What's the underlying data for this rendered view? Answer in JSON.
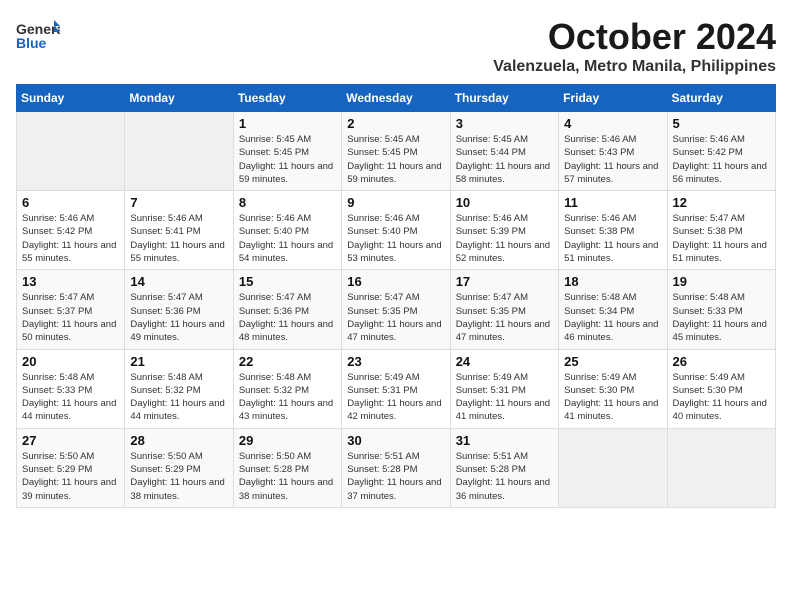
{
  "logo": {
    "general": "General",
    "blue": "Blue"
  },
  "title": "October 2024",
  "location": "Valenzuela, Metro Manila, Philippines",
  "weekdays": [
    "Sunday",
    "Monday",
    "Tuesday",
    "Wednesday",
    "Thursday",
    "Friday",
    "Saturday"
  ],
  "weeks": [
    [
      {
        "day": "",
        "info": ""
      },
      {
        "day": "",
        "info": ""
      },
      {
        "day": "1",
        "info": "Sunrise: 5:45 AM\nSunset: 5:45 PM\nDaylight: 11 hours and 59 minutes."
      },
      {
        "day": "2",
        "info": "Sunrise: 5:45 AM\nSunset: 5:45 PM\nDaylight: 11 hours and 59 minutes."
      },
      {
        "day": "3",
        "info": "Sunrise: 5:45 AM\nSunset: 5:44 PM\nDaylight: 11 hours and 58 minutes."
      },
      {
        "day": "4",
        "info": "Sunrise: 5:46 AM\nSunset: 5:43 PM\nDaylight: 11 hours and 57 minutes."
      },
      {
        "day": "5",
        "info": "Sunrise: 5:46 AM\nSunset: 5:42 PM\nDaylight: 11 hours and 56 minutes."
      }
    ],
    [
      {
        "day": "6",
        "info": "Sunrise: 5:46 AM\nSunset: 5:42 PM\nDaylight: 11 hours and 55 minutes."
      },
      {
        "day": "7",
        "info": "Sunrise: 5:46 AM\nSunset: 5:41 PM\nDaylight: 11 hours and 55 minutes."
      },
      {
        "day": "8",
        "info": "Sunrise: 5:46 AM\nSunset: 5:40 PM\nDaylight: 11 hours and 54 minutes."
      },
      {
        "day": "9",
        "info": "Sunrise: 5:46 AM\nSunset: 5:40 PM\nDaylight: 11 hours and 53 minutes."
      },
      {
        "day": "10",
        "info": "Sunrise: 5:46 AM\nSunset: 5:39 PM\nDaylight: 11 hours and 52 minutes."
      },
      {
        "day": "11",
        "info": "Sunrise: 5:46 AM\nSunset: 5:38 PM\nDaylight: 11 hours and 51 minutes."
      },
      {
        "day": "12",
        "info": "Sunrise: 5:47 AM\nSunset: 5:38 PM\nDaylight: 11 hours and 51 minutes."
      }
    ],
    [
      {
        "day": "13",
        "info": "Sunrise: 5:47 AM\nSunset: 5:37 PM\nDaylight: 11 hours and 50 minutes."
      },
      {
        "day": "14",
        "info": "Sunrise: 5:47 AM\nSunset: 5:36 PM\nDaylight: 11 hours and 49 minutes."
      },
      {
        "day": "15",
        "info": "Sunrise: 5:47 AM\nSunset: 5:36 PM\nDaylight: 11 hours and 48 minutes."
      },
      {
        "day": "16",
        "info": "Sunrise: 5:47 AM\nSunset: 5:35 PM\nDaylight: 11 hours and 47 minutes."
      },
      {
        "day": "17",
        "info": "Sunrise: 5:47 AM\nSunset: 5:35 PM\nDaylight: 11 hours and 47 minutes."
      },
      {
        "day": "18",
        "info": "Sunrise: 5:48 AM\nSunset: 5:34 PM\nDaylight: 11 hours and 46 minutes."
      },
      {
        "day": "19",
        "info": "Sunrise: 5:48 AM\nSunset: 5:33 PM\nDaylight: 11 hours and 45 minutes."
      }
    ],
    [
      {
        "day": "20",
        "info": "Sunrise: 5:48 AM\nSunset: 5:33 PM\nDaylight: 11 hours and 44 minutes."
      },
      {
        "day": "21",
        "info": "Sunrise: 5:48 AM\nSunset: 5:32 PM\nDaylight: 11 hours and 44 minutes."
      },
      {
        "day": "22",
        "info": "Sunrise: 5:48 AM\nSunset: 5:32 PM\nDaylight: 11 hours and 43 minutes."
      },
      {
        "day": "23",
        "info": "Sunrise: 5:49 AM\nSunset: 5:31 PM\nDaylight: 11 hours and 42 minutes."
      },
      {
        "day": "24",
        "info": "Sunrise: 5:49 AM\nSunset: 5:31 PM\nDaylight: 11 hours and 41 minutes."
      },
      {
        "day": "25",
        "info": "Sunrise: 5:49 AM\nSunset: 5:30 PM\nDaylight: 11 hours and 41 minutes."
      },
      {
        "day": "26",
        "info": "Sunrise: 5:49 AM\nSunset: 5:30 PM\nDaylight: 11 hours and 40 minutes."
      }
    ],
    [
      {
        "day": "27",
        "info": "Sunrise: 5:50 AM\nSunset: 5:29 PM\nDaylight: 11 hours and 39 minutes."
      },
      {
        "day": "28",
        "info": "Sunrise: 5:50 AM\nSunset: 5:29 PM\nDaylight: 11 hours and 38 minutes."
      },
      {
        "day": "29",
        "info": "Sunrise: 5:50 AM\nSunset: 5:28 PM\nDaylight: 11 hours and 38 minutes."
      },
      {
        "day": "30",
        "info": "Sunrise: 5:51 AM\nSunset: 5:28 PM\nDaylight: 11 hours and 37 minutes."
      },
      {
        "day": "31",
        "info": "Sunrise: 5:51 AM\nSunset: 5:28 PM\nDaylight: 11 hours and 36 minutes."
      },
      {
        "day": "",
        "info": ""
      },
      {
        "day": "",
        "info": ""
      }
    ]
  ]
}
